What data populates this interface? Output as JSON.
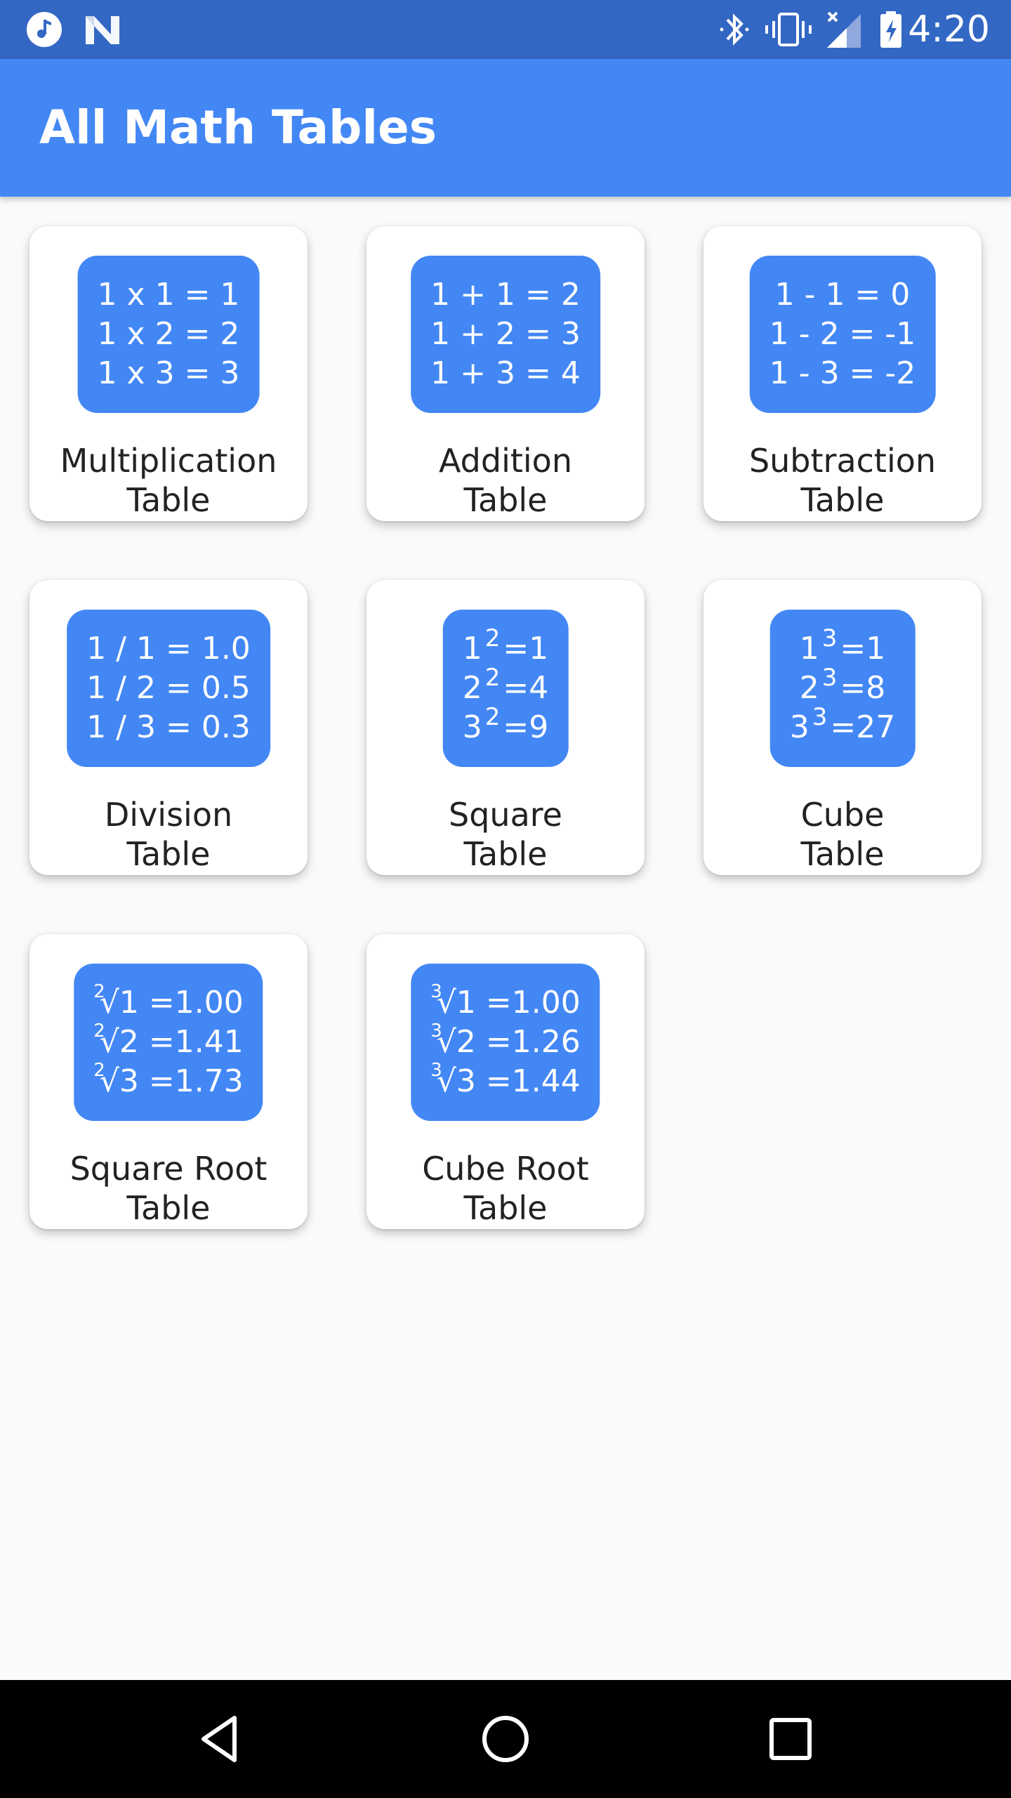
{
  "status_bar": {
    "time": "4:20",
    "left_icons": [
      "music-icon",
      "n-logo-icon"
    ],
    "right_icons": [
      "bluetooth-icon",
      "vibrate-icon",
      "signal-icon",
      "battery-icon"
    ]
  },
  "app_bar": {
    "title": "All Math Tables"
  },
  "cards": [
    {
      "label_line1": "Multiplication",
      "label_line2": "Table",
      "rows": [
        "1 x 1 = 1",
        "1 x 2 = 2",
        "1 x 3 = 3"
      ]
    },
    {
      "label_line1": "Addition",
      "label_line2": "Table",
      "rows": [
        "1 + 1 = 2",
        "1 + 2 = 3",
        "1 + 3 = 4"
      ]
    },
    {
      "label_line1": "Subtraction",
      "label_line2": "Table",
      "rows": [
        "1 - 1 = 0",
        "1 - 2 = -1",
        "1 - 3 = -2"
      ]
    },
    {
      "label_line1": "Division",
      "label_line2": "Table",
      "rows": [
        "1 / 1 = 1.0",
        "1 / 2 = 0.5",
        "1 / 3 = 0.3"
      ]
    },
    {
      "label_line1": "Square",
      "label_line2": "Table",
      "rows": [
        {
          "base": "1",
          "exp": "2",
          "result": "=1"
        },
        {
          "base": "2",
          "exp": "2",
          "result": "=4"
        },
        {
          "base": "3",
          "exp": "2",
          "result": "=9"
        }
      ]
    },
    {
      "label_line1": "Cube",
      "label_line2": "Table",
      "rows": [
        {
          "base": "1",
          "exp": "3",
          "result": "=1"
        },
        {
          "base": "2",
          "exp": "3",
          "result": "=8"
        },
        {
          "base": "3",
          "exp": "3",
          "result": "=27"
        }
      ]
    },
    {
      "label_line1": "Square Root",
      "label_line2": "Table",
      "rows": [
        {
          "index": "2",
          "radical": "√",
          "value": "1 =1.00"
        },
        {
          "index": "2",
          "radical": "√",
          "value": "2 =1.41"
        },
        {
          "index": "2",
          "radical": "√",
          "value": "3 =1.73"
        }
      ]
    },
    {
      "label_line1": "Cube Root",
      "label_line2": "Table",
      "rows": [
        {
          "index": "3",
          "radical": "√",
          "value": "1 =1.00"
        },
        {
          "index": "3",
          "radical": "√",
          "value": "2 =1.26"
        },
        {
          "index": "3",
          "radical": "√",
          "value": "3 =1.44"
        }
      ]
    }
  ],
  "nav_bar": {
    "icons": [
      "back-icon",
      "home-icon",
      "recents-icon"
    ]
  },
  "colors": {
    "status_bar": "#3367c4",
    "app_bar": "#4387f5",
    "badge": "#4387f5"
  }
}
